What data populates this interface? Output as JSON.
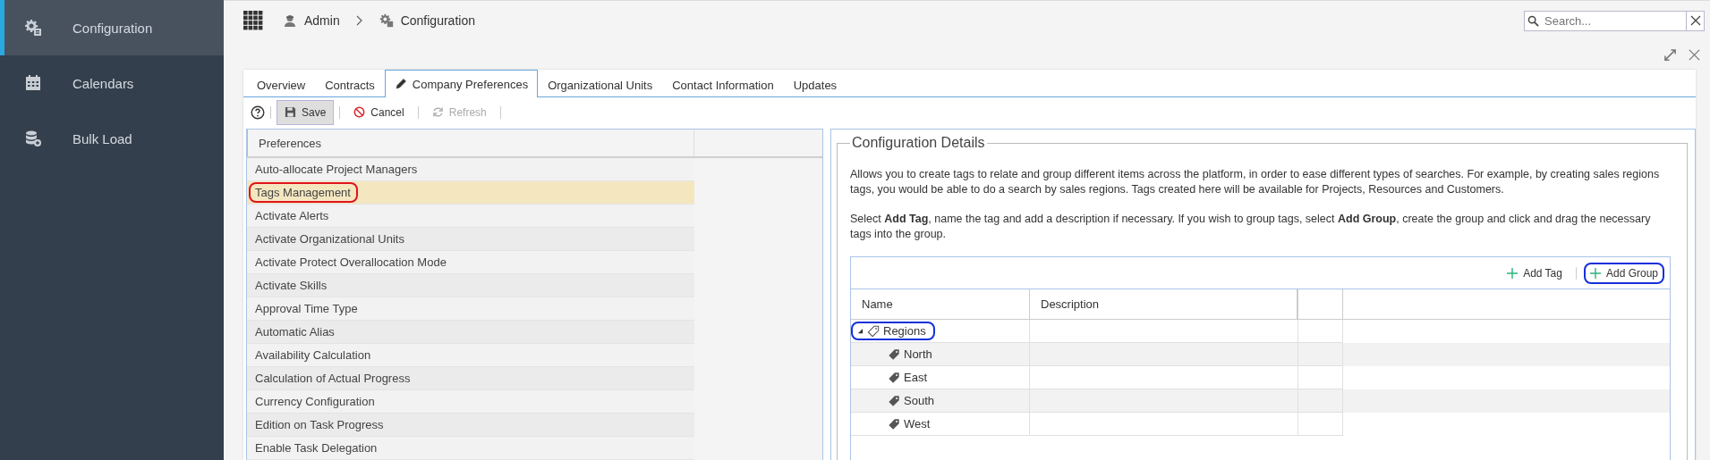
{
  "sidebar": {
    "items": [
      {
        "label": "Configuration",
        "selected": true
      },
      {
        "label": "Calendars",
        "selected": false
      },
      {
        "label": "Bulk Load",
        "selected": false
      }
    ]
  },
  "breadcrumb": [
    {
      "label": "Admin"
    },
    {
      "label": "Configuration"
    }
  ],
  "search": {
    "placeholder": "Search..."
  },
  "tabs": [
    {
      "label": "Overview",
      "selected": false
    },
    {
      "label": "Contracts",
      "selected": false
    },
    {
      "label": "Company Preferences",
      "selected": true
    },
    {
      "label": "Organizational Units",
      "selected": false
    },
    {
      "label": "Contact Information",
      "selected": false
    },
    {
      "label": "Updates",
      "selected": false
    }
  ],
  "toolbar": [
    {
      "kind": "help"
    },
    {
      "kind": "save",
      "label": "Save",
      "disabled": false,
      "pressed": true
    },
    {
      "kind": "cancel",
      "label": "Cancel",
      "disabled": false,
      "pressed": false
    },
    {
      "kind": "refresh",
      "label": "Refresh",
      "disabled": true,
      "pressed": false
    }
  ],
  "preferences": {
    "header": "Preferences",
    "items": [
      {
        "label": "Auto-allocate Project Managers",
        "selected": false,
        "circled": false
      },
      {
        "label": "Tags Management",
        "selected": true,
        "circled": true
      },
      {
        "label": "Activate Alerts",
        "selected": false,
        "circled": false
      },
      {
        "label": "Activate Organizational Units",
        "selected": false,
        "circled": false
      },
      {
        "label": "Activate Protect Overallocation Mode",
        "selected": false,
        "circled": false
      },
      {
        "label": "Activate Skills",
        "selected": false,
        "circled": false
      },
      {
        "label": "Approval Time Type",
        "selected": false,
        "circled": false
      },
      {
        "label": "Automatic Alias",
        "selected": false,
        "circled": false
      },
      {
        "label": "Availability Calculation",
        "selected": false,
        "circled": false
      },
      {
        "label": "Calculation of Actual Progress",
        "selected": false,
        "circled": false
      },
      {
        "label": "Currency Configuration",
        "selected": false,
        "circled": false
      },
      {
        "label": "Edition on Task Progress",
        "selected": false,
        "circled": false
      },
      {
        "label": "Enable Task Delegation",
        "selected": false,
        "circled": false
      }
    ]
  },
  "details": {
    "title": "Configuration Details",
    "paragraphs": [
      "Allows you to create tags to relate and group different items across the platform, in order to ease different types of searches.   For example, by creating sales regions tags, you would be able to do a search by sales regions.  Tags created here will be available for Projects, Resources and Customers.",
      "Select **Add Tag**, name the tag and add a description if necessary.  If you wish to group tags, select **Add Group**, create the group and click and drag the necessary tags into the group."
    ],
    "actions": [
      {
        "label": "Add Tag",
        "circled": false
      },
      {
        "label": "Add Group",
        "circled": true
      }
    ],
    "columns": [
      "Name",
      "Description"
    ],
    "tree": [
      {
        "name": "Regions",
        "kind": "group",
        "expanded": true,
        "circled": true,
        "children": [
          {
            "name": "North",
            "kind": "tag",
            "circled": false
          },
          {
            "name": "East",
            "kind": "tag",
            "circled": false
          },
          {
            "name": "South",
            "kind": "tag",
            "circled": false
          },
          {
            "name": "West",
            "kind": "tag",
            "circled": false
          }
        ]
      }
    ]
  }
}
